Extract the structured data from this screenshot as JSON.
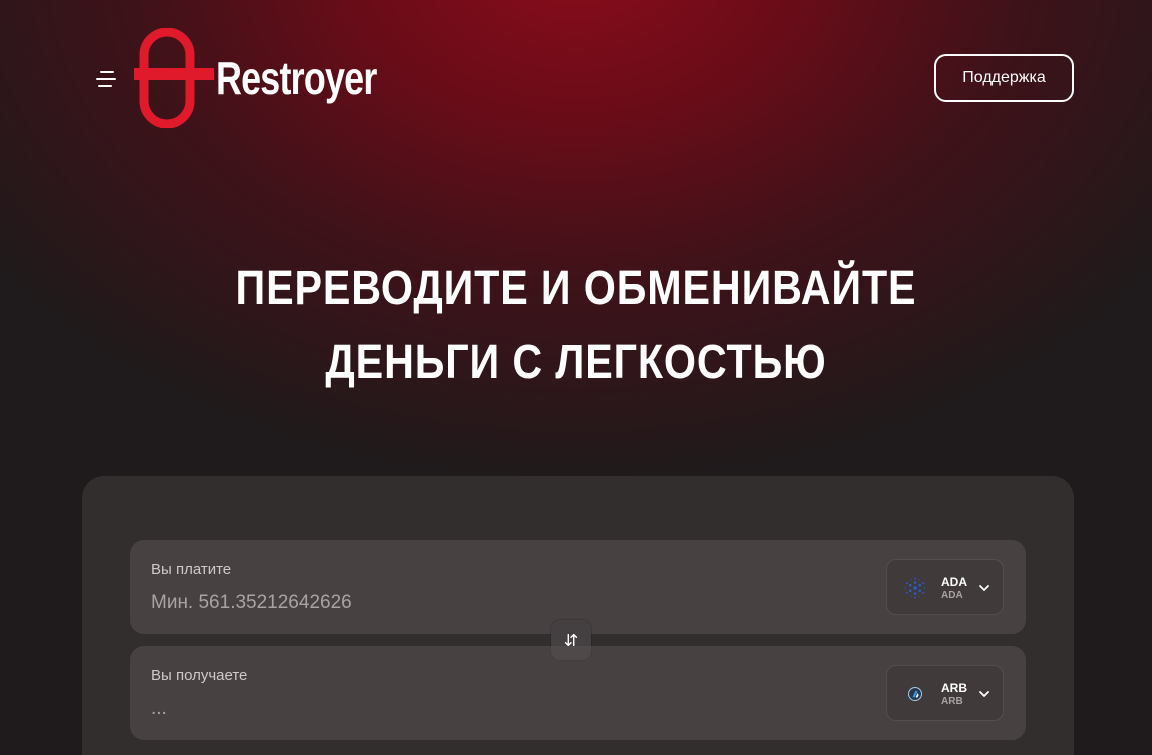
{
  "header": {
    "brand": "Restroyer",
    "support_label": "Поддержка"
  },
  "hero": {
    "line1": "ПЕРЕВОДИТЕ И ОБМЕНИВАЙТЕ",
    "line2": "ДЕНЬГИ С ЛЕГКОСТЬЮ"
  },
  "exchange": {
    "pay": {
      "label": "Вы платите",
      "placeholder": "Мин. 561.35212642626",
      "currency_code": "ADA",
      "currency_sub": "ADA",
      "icon": "cardano-icon"
    },
    "receive": {
      "label": "Вы получаете",
      "placeholder": "...",
      "currency_code": "ARB",
      "currency_sub": "ARB",
      "icon": "arbitrum-icon"
    }
  },
  "colors": {
    "brand_red": "#e01a2b",
    "panel": "#3c3636",
    "cardano_blue": "#2a5bd7"
  }
}
